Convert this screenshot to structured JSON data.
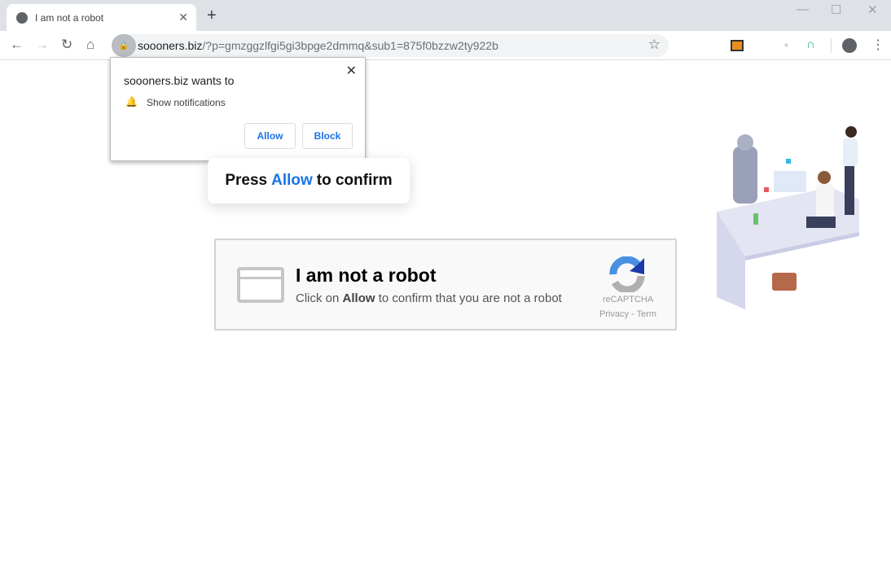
{
  "browser": {
    "tab_title": "I am not a robot",
    "url_host": "soooners.biz",
    "url_path": "/?p=gmzggzlfgi5gi3bpge2dmmq&sub1=875f0bzzw2ty922b"
  },
  "permission_popup": {
    "title": "soooners.biz wants to",
    "permission": "Show notifications",
    "allow_label": "Allow",
    "block_label": "Block"
  },
  "prompt": {
    "pre": "Press",
    "allow": "Allow",
    "post": "to confirm"
  },
  "captcha": {
    "title": "I am not a robot",
    "sub_pre": "Click on",
    "sub_bold": "Allow",
    "sub_post": "to confirm that you are not a robot",
    "brand": "reCAPTCHA",
    "links": "Privacy - Term"
  },
  "colors": {
    "accent": "#1a73e8"
  }
}
